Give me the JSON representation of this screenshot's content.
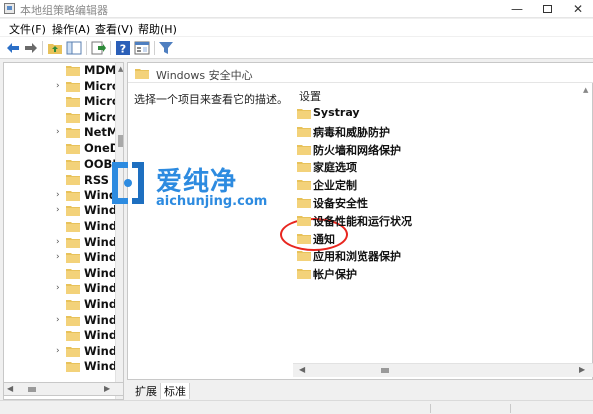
{
  "window": {
    "title": "本地组策略编辑器",
    "minimize": "—",
    "close": "✕"
  },
  "menu": {
    "file": "文件(F)",
    "action": "操作(A)",
    "view": "查看(V)",
    "help": "帮助(H)"
  },
  "tree": {
    "items": [
      {
        "label": "MDM",
        "expander": ""
      },
      {
        "label": "Microsoft",
        "expander": "›"
      },
      {
        "label": "Microsoft",
        "expander": ""
      },
      {
        "label": "Microsoft",
        "expander": ""
      },
      {
        "label": "NetMeeting",
        "expander": "›"
      },
      {
        "label": "OneDrive",
        "expander": ""
      },
      {
        "label": "OOBE",
        "expander": ""
      },
      {
        "label": "RSS 源",
        "expander": ""
      },
      {
        "label": "Windows",
        "expander": "›"
      },
      {
        "label": "Windows",
        "expander": "›"
      },
      {
        "label": "Windows",
        "expander": ""
      },
      {
        "label": "Windows",
        "expander": "›"
      },
      {
        "label": "Windows",
        "expander": "›"
      },
      {
        "label": "Windows",
        "expander": ""
      },
      {
        "label": "Windows",
        "expander": "›"
      },
      {
        "label": "Windows",
        "expander": ""
      },
      {
        "label": "Windows",
        "expander": "›"
      },
      {
        "label": "Windows",
        "expander": ""
      },
      {
        "label": "Windows",
        "expander": "›"
      },
      {
        "label": "Windows",
        "expander": ""
      }
    ]
  },
  "right": {
    "header_title": "Windows 安全中心",
    "description": "选择一个项目来查看它的描述。",
    "list_header": "设置",
    "items": [
      "Systray",
      "病毒和威胁防护",
      "防火墙和网络保护",
      "家庭选项",
      "企业定制",
      "设备安全性",
      "设备性能和运行状况",
      "通知",
      "应用和浏览器保护",
      "帐户保护"
    ]
  },
  "tabs": {
    "extended": "扩展",
    "standard": "标准"
  },
  "watermark": {
    "title": "爱纯净",
    "url": "aichunjing.com"
  },
  "colors": {
    "folder": "#e8c25a",
    "highlight_circle": "#e8261f",
    "watermark": "#2d8be0"
  }
}
